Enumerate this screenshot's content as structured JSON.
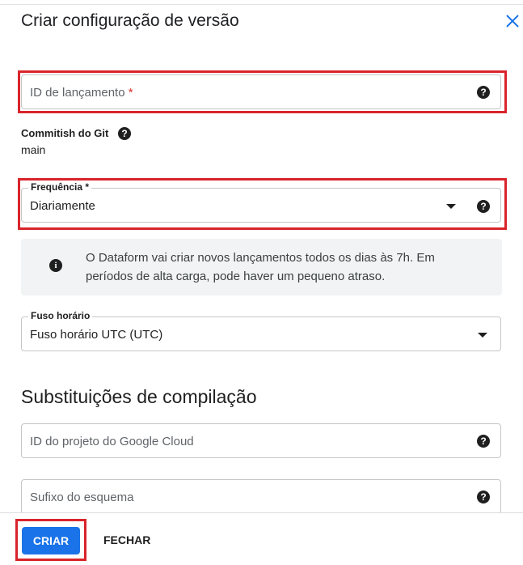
{
  "dialog": {
    "title": "Criar configuração de versão",
    "close_icon": "close-icon"
  },
  "release_id": {
    "placeholder": "ID de lançamento",
    "required_mark": "*",
    "help_icon": "help-icon"
  },
  "git_commitish": {
    "label": "Commitish do Git",
    "value": "main",
    "help_icon": "help-icon"
  },
  "frequency": {
    "label": "Frequência *",
    "value": "Diariamente",
    "dropdown_icon": "arrow-drop-down-icon",
    "help_icon": "help-icon"
  },
  "info": {
    "icon": "info-icon",
    "text": "O Dataform vai criar novos lançamentos todos os dias às 7h. Em períodos de alta carga, pode haver um pequeno atraso."
  },
  "timezone": {
    "label": "Fuso horário",
    "value": "Fuso horário UTC (UTC)",
    "dropdown_icon": "arrow-drop-down-icon"
  },
  "overrides": {
    "title": "Substituições de compilação",
    "project_id_placeholder": "ID do projeto do Google Cloud",
    "schema_suffix_placeholder": "Sufixo do esquema"
  },
  "footer": {
    "create_label": "CRIAR",
    "close_label": "FECHAR"
  },
  "colors": {
    "primary": "#1a73e8",
    "highlight": "#d9242b",
    "info_bg": "#f1f3f4"
  }
}
